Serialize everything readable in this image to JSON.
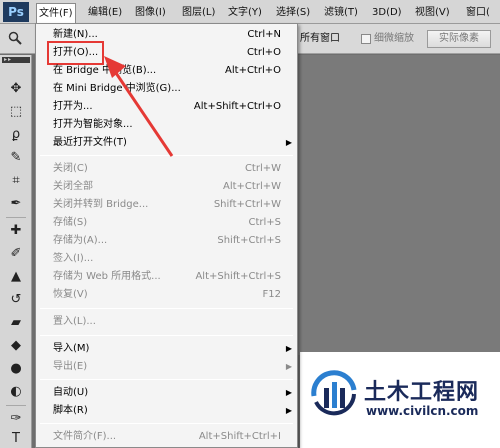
{
  "app": {
    "logo": "Ps"
  },
  "menubar": {
    "items": [
      "文件(F)",
      "编辑(E)",
      "图像(I)",
      "图层(L)",
      "文字(Y)",
      "选择(S)",
      "滤镜(T)",
      "3D(D)",
      "视图(V)",
      "窗口("
    ]
  },
  "options": {
    "all_windows": "所有窗口",
    "fine_zoom": "细微缩放",
    "actual_pixels": "实际像素"
  },
  "file_menu": {
    "items": [
      {
        "label": "新建(N)...",
        "shortcut": "Ctrl+N"
      },
      {
        "label": "打开(O)...",
        "shortcut": "Ctrl+O"
      },
      {
        "label": "在 Bridge 中浏览(B)...",
        "shortcut": "Alt+Ctrl+O"
      },
      {
        "label": "在 Mini Bridge 中浏览(G)...",
        "shortcut": ""
      },
      {
        "label": "打开为...",
        "shortcut": "Alt+Shift+Ctrl+O"
      },
      {
        "label": "打开为智能对象...",
        "shortcut": ""
      },
      {
        "label": "最近打开文件(T)",
        "shortcut": ""
      },
      {
        "label": "关闭(C)",
        "shortcut": "Ctrl+W"
      },
      {
        "label": "关闭全部",
        "shortcut": "Alt+Ctrl+W"
      },
      {
        "label": "关闭并转到 Bridge...",
        "shortcut": "Shift+Ctrl+W"
      },
      {
        "label": "存储(S)",
        "shortcut": "Ctrl+S"
      },
      {
        "label": "存储为(A)...",
        "shortcut": "Shift+Ctrl+S"
      },
      {
        "label": "签入(I)...",
        "shortcut": ""
      },
      {
        "label": "存储为 Web 所用格式...",
        "shortcut": "Alt+Shift+Ctrl+S"
      },
      {
        "label": "恢复(V)",
        "shortcut": "F12"
      },
      {
        "label": "置入(L)...",
        "shortcut": ""
      },
      {
        "label": "导入(M)",
        "shortcut": ""
      },
      {
        "label": "导出(E)",
        "shortcut": ""
      },
      {
        "label": "自动(U)",
        "shortcut": ""
      },
      {
        "label": "脚本(R)",
        "shortcut": ""
      },
      {
        "label": "文件简介(F)...",
        "shortcut": "Alt+Shift+Ctrl+I"
      }
    ]
  },
  "watermark": {
    "name": "土木工程网",
    "url": "www.civilcn.com"
  },
  "colors": {
    "highlight_box": "#e53935",
    "arrow": "#e53935",
    "ps_logo_bg": "#1e3a5e"
  }
}
